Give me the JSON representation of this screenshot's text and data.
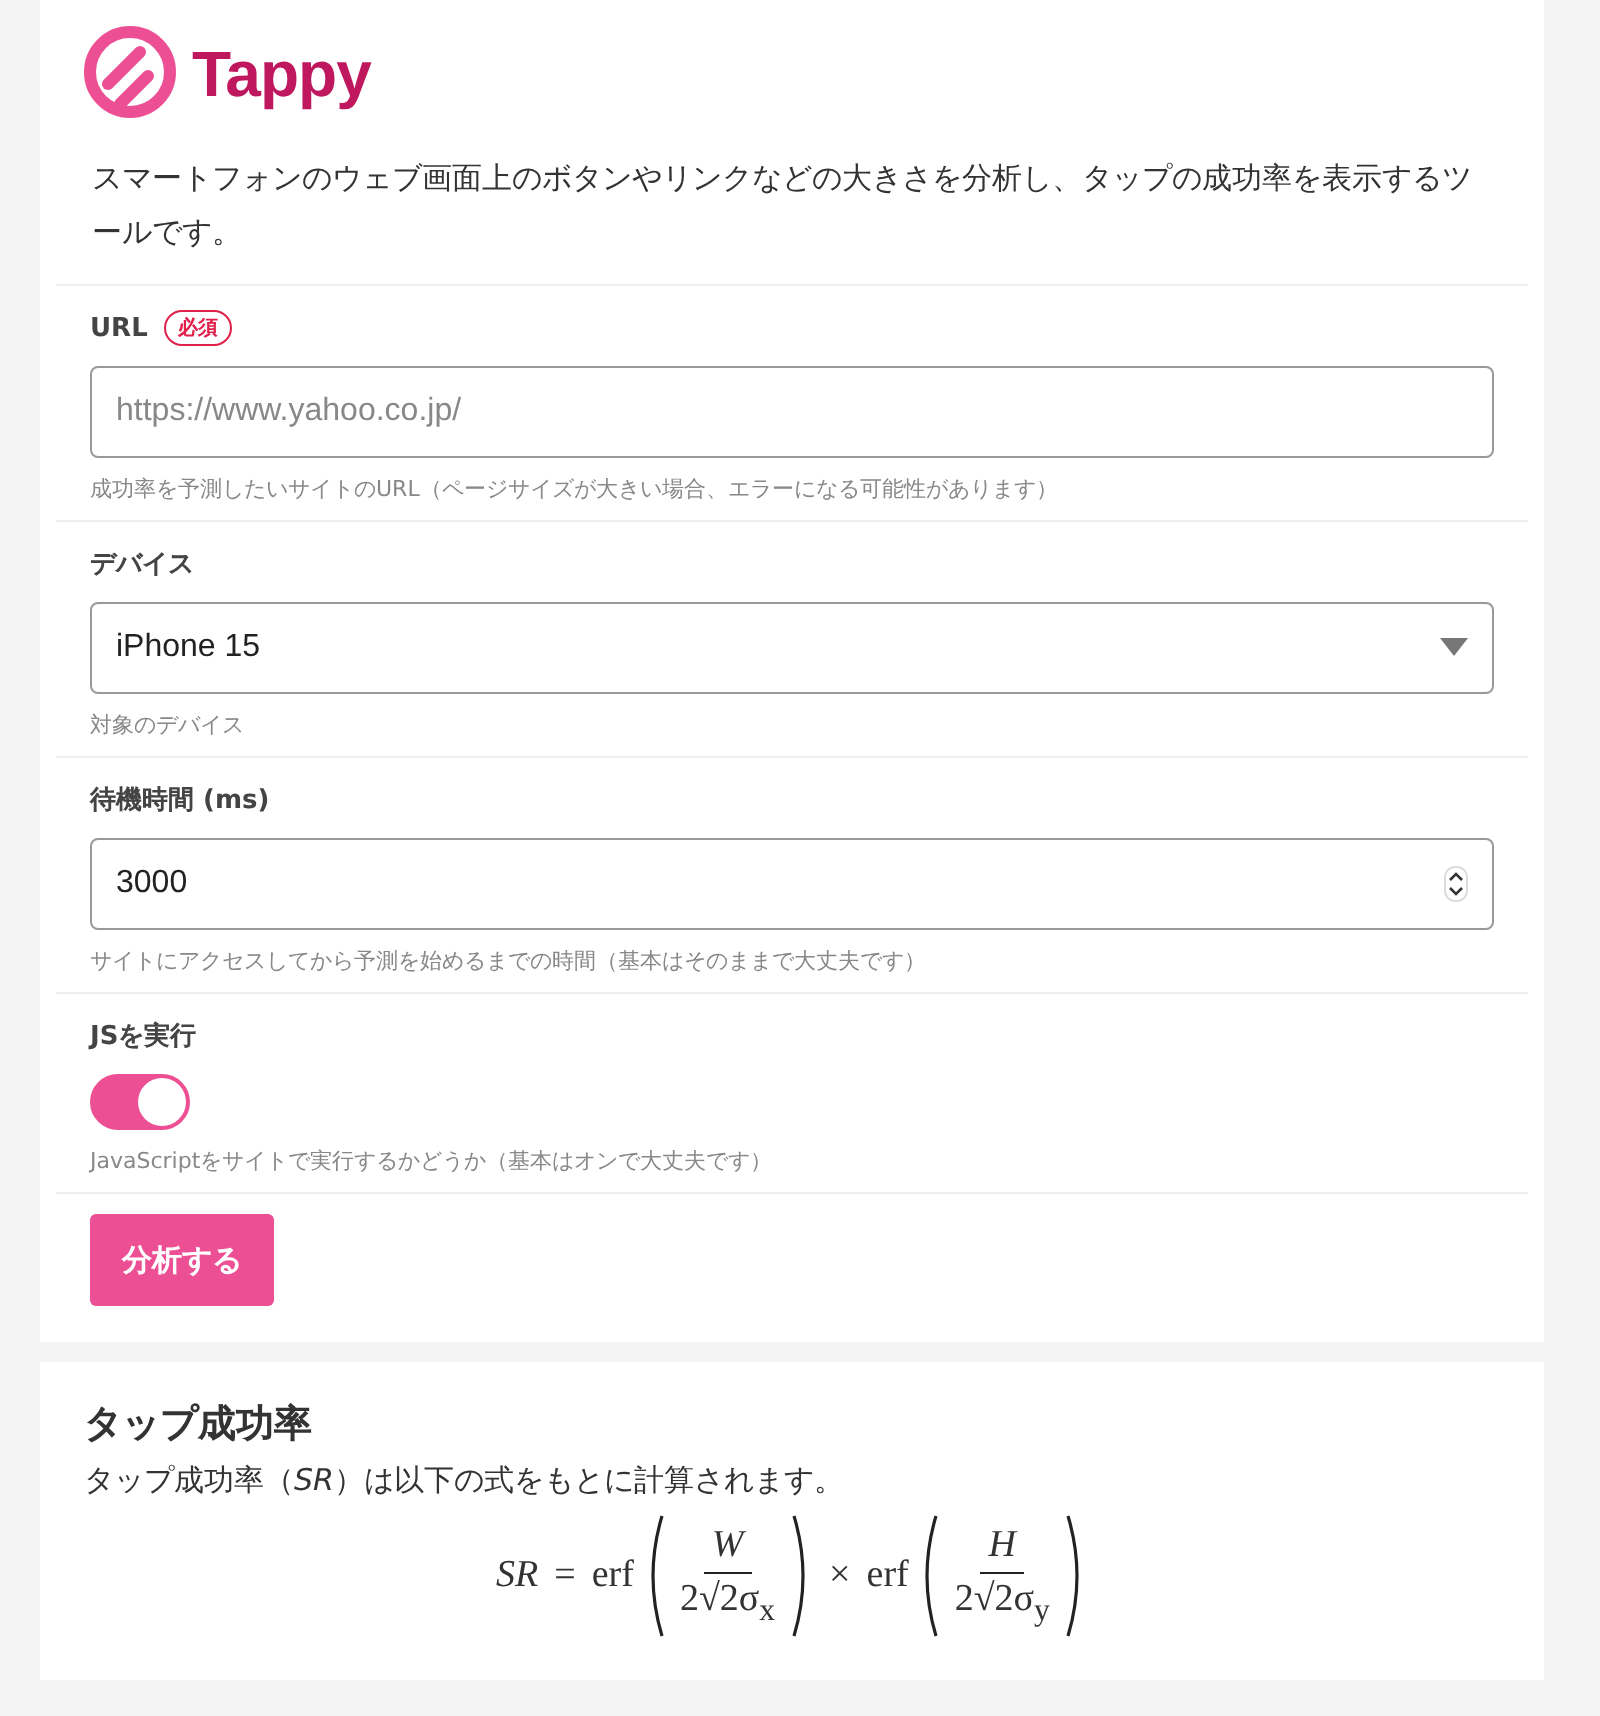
{
  "logo": {
    "text": "Tappy"
  },
  "description": "スマートフォンのウェブ画面上のボタンやリンクなどの大きさを分析し、タップの成功率を表示するツールです。",
  "fields": [
    {
      "kind": "text",
      "label": "URL",
      "badge": "必須",
      "placeholder": "https://www.yahoo.co.jp/",
      "help": "成功率を予測したいサイトのURL（ページサイズが大きい場合、エラーになる可能性があります）"
    },
    {
      "kind": "select",
      "label": "デバイス",
      "value": "iPhone 15",
      "help": "対象のデバイス"
    },
    {
      "kind": "number",
      "label": "待機時間 (ms)",
      "value": "3000",
      "help": "サイトにアクセスしてから予測を始めるまでの時間（基本はそのままで大丈夫です）"
    },
    {
      "kind": "toggle",
      "label": "JSを実行",
      "on": true,
      "help": "JavaScriptをサイトで実行するかどうか（基本はオンで大丈夫です）"
    }
  ],
  "submit_button": "分析する",
  "section": {
    "title": "タップ成功率",
    "text": "タップ成功率（*SR*）は以下の式をもとに計算されます。",
    "formula": {
      "lhs": "SR",
      "equals": "=",
      "operator": "×",
      "terms": [
        {
          "func": "erf",
          "numerator": "W",
          "denominator": "2√2σ$_{x}$"
        },
        {
          "func": "erf",
          "numerator": "H",
          "denominator": "2√2σ$_{y}$"
        }
      ]
    }
  }
}
